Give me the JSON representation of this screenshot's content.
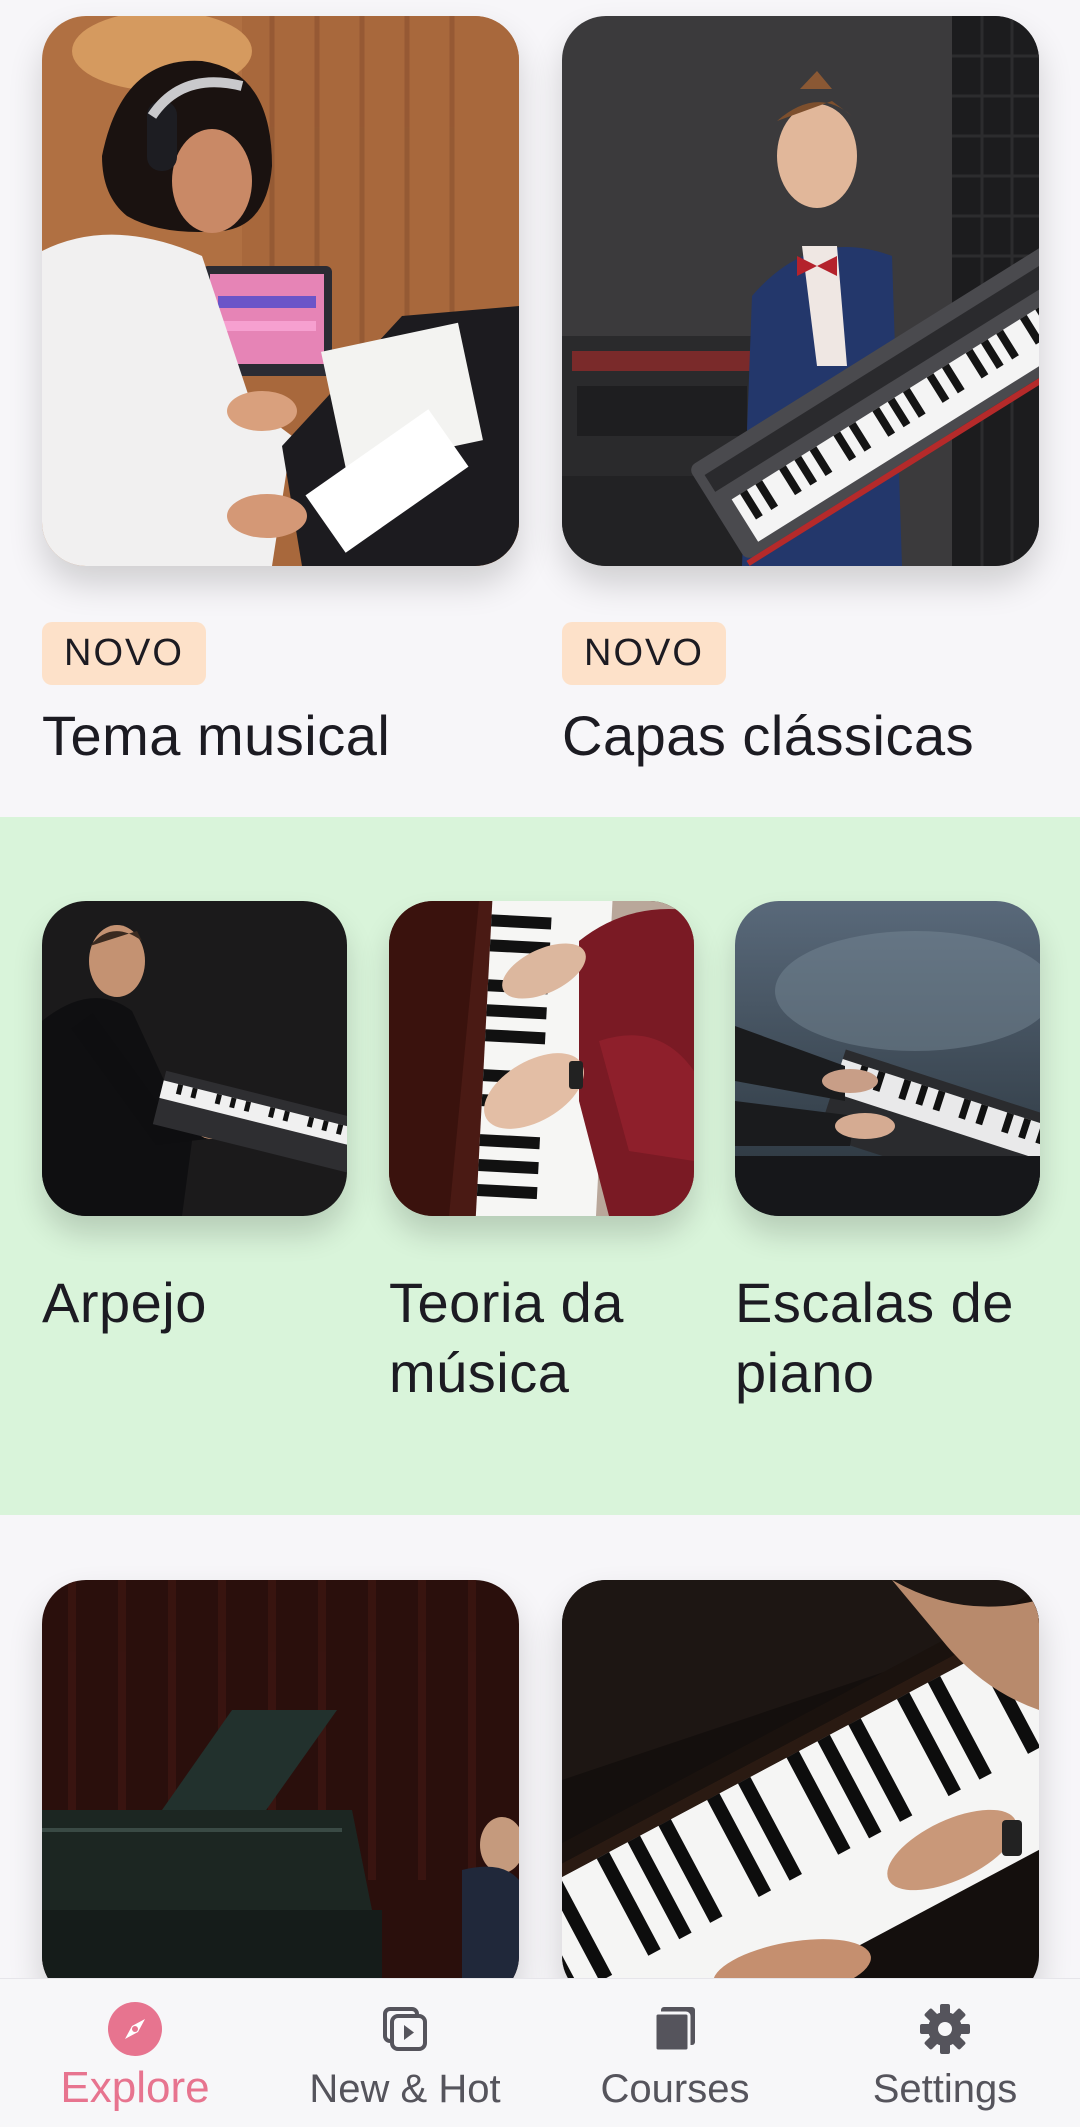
{
  "top_cards": [
    {
      "badge": "NOVO",
      "title": "Tema musical"
    },
    {
      "badge": "NOVO",
      "title": "Capas clássicas"
    }
  ],
  "green_cards": [
    {
      "title": "Arpejo"
    },
    {
      "title": "Teoria da música"
    },
    {
      "title": "Escalas de piano"
    }
  ],
  "bottom_nav": {
    "items": [
      {
        "label": "Explore",
        "icon": "compass-icon",
        "active": true
      },
      {
        "label": "New & Hot",
        "icon": "play-stack-icon",
        "active": false
      },
      {
        "label": "Courses",
        "icon": "book-icon",
        "active": false
      },
      {
        "label": "Settings",
        "icon": "gear-icon",
        "active": false
      }
    ]
  },
  "colors": {
    "accent": "#e7748f",
    "badge_bg": "#fde1c9",
    "green_section": "#d9f4da",
    "background": "#f7f6f9"
  }
}
